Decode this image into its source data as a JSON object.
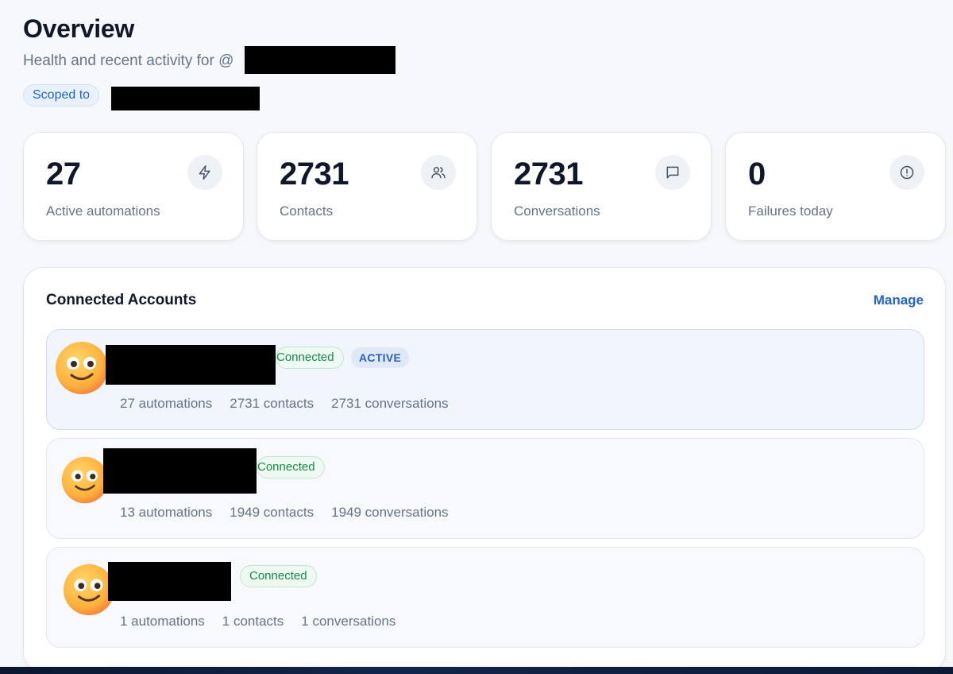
{
  "header": {
    "title": "Overview",
    "subtitle": "Health and recent activity for @",
    "scope_label": "Scoped to"
  },
  "stats": [
    {
      "value": "27",
      "label": "Active automations",
      "icon": "lightning-icon"
    },
    {
      "value": "2731",
      "label": "Contacts",
      "icon": "users-icon"
    },
    {
      "value": "2731",
      "label": "Conversations",
      "icon": "message-icon"
    },
    {
      "value": "0",
      "label": "Failures today",
      "icon": "alert-circle-icon"
    }
  ],
  "accounts_panel": {
    "title": "Connected Accounts",
    "manage_label": "Manage",
    "accounts": [
      {
        "status": "Connected",
        "active_label": "ACTIVE",
        "automations": "27 automations",
        "contacts": "2731 contacts",
        "conversations": "2731 conversations"
      },
      {
        "status": "Connected",
        "automations": "13 automations",
        "contacts": "1949 contacts",
        "conversations": "1949 conversations"
      },
      {
        "status": "Connected",
        "automations": "1 automations",
        "contacts": "1 contacts",
        "conversations": "1 conversations"
      }
    ]
  },
  "colors": {
    "accent": "#2563c4",
    "connected": "#158a4a",
    "background": "#f6f8fb"
  }
}
